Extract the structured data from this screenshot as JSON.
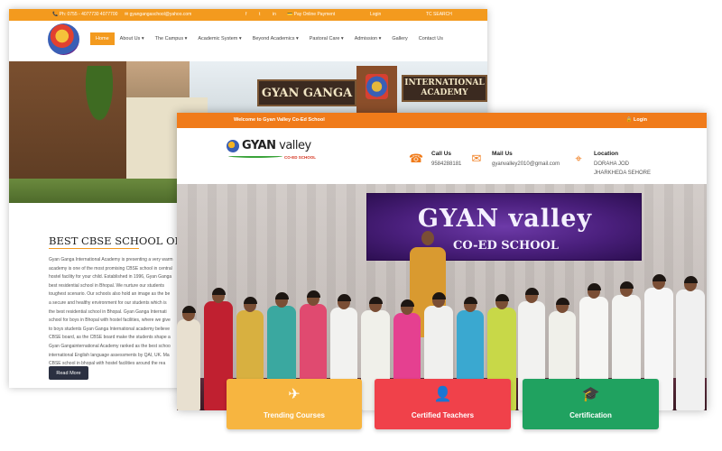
{
  "back": {
    "topbar": {
      "phone": "📞 Ph: 0755 - 4077730 4077700",
      "email": "✉ gyangangaschool@yahoo.com",
      "social": [
        "f",
        "t",
        "in"
      ],
      "pay": "💳 Pay Online Payment",
      "login": "Login",
      "search": "TC SEARCH"
    },
    "menu": [
      {
        "label": "Home",
        "active": true
      },
      {
        "label": "About Us ▾"
      },
      {
        "label": "The Campus ▾"
      },
      {
        "label": "Academic System ▾"
      },
      {
        "label": "Beyond Academics ▾"
      },
      {
        "label": "Pastoral Care ▾"
      },
      {
        "label": "Admission ▾"
      },
      {
        "label": "Gallery"
      },
      {
        "label": "Contact Us"
      }
    ],
    "hero": {
      "sign1": "GYAN GANGA",
      "sign2_line1": "INTERNATIONAL",
      "sign2_line2": "ACADEMY"
    },
    "heading": "BEST CBSE SCHOOL OF BH",
    "paragraph": [
      "Gyan Ganga International Academy is presenting a very warm",
      "academy is one of the most promising CBSE school in central",
      "hostel facility for your child. Established in 1996, Gyan Ganga",
      "best residential school in Bhopal. We nurture our students",
      "toughest scenario. Our schools also hold an image as the be",
      "a secure and healthy environment for our students which is",
      "the best residential school in Bhopal. Gyan Ganga Internati",
      "school for boys in Bhopal with hostel facilities, where we give",
      "to boys students Gyan Ganga International academy believe",
      "CBSE board, as the CBSE board make the students shape a",
      "Gyan Gangainternational Academy ranked as the best schoo",
      "international English language assessments by QAI, UK. Ma",
      "CBSE school in bhopal with hostel facilities around the rea"
    ],
    "read_more": "Read More"
  },
  "front": {
    "topbar": {
      "welcome": "Welcome to Gyan Valley Co-Ed School",
      "login": "🔒 Login"
    },
    "logo": {
      "brand_bold": "GYAN",
      "brand_rest": " valley",
      "sub": "CO-ED SCHOOL"
    },
    "contacts": [
      {
        "icon": "phone-icon",
        "glyph": "☎",
        "label": "Call Us",
        "value": "9584288181"
      },
      {
        "icon": "mail-icon",
        "glyph": "✉",
        "label": "Mail Us",
        "value": "gyanvalley2010@gmail.com"
      },
      {
        "icon": "location-icon",
        "glyph": "⌖",
        "label": "Location",
        "value": "DORAHA JOD",
        "value2": "JHARKHEDA SEHORE"
      }
    ],
    "banner": {
      "line1": "GYAN valley",
      "line2": "CO-ED SCHOOL"
    },
    "cards": [
      {
        "label": "Trending Courses",
        "glyph": "✈",
        "color": "#f7b540"
      },
      {
        "label": "Certified Teachers",
        "glyph": "👤",
        "color": "#f0414a"
      },
      {
        "label": "Certification",
        "glyph": "🎓",
        "color": "#20a260"
      }
    ]
  }
}
